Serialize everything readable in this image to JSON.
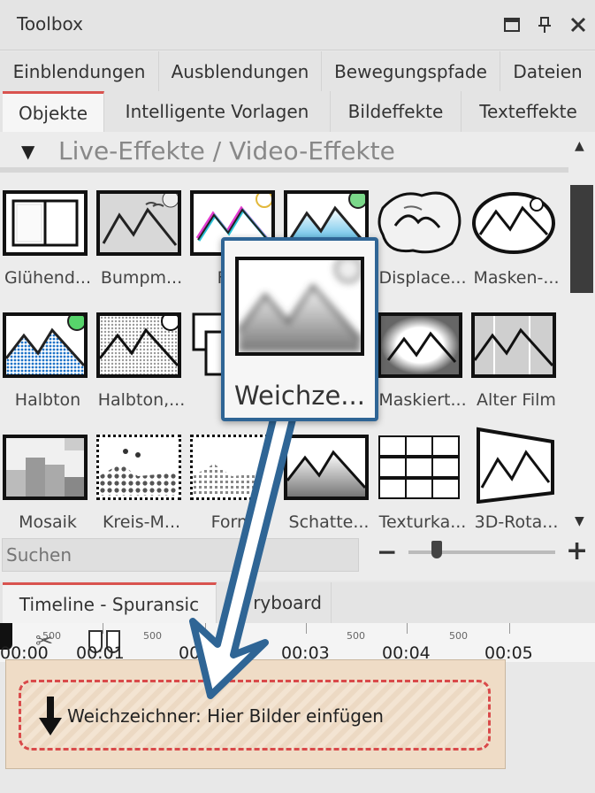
{
  "window": {
    "title": "Toolbox"
  },
  "tabs_row1": [
    "Einblendungen",
    "Ausblendungen",
    "Bewegungspfade",
    "Dateien"
  ],
  "tabs_row2": [
    "Objekte",
    "Intelligente Vorlagen",
    "Bildeffekte",
    "Texteffekte"
  ],
  "active_tab": "Objekte",
  "section": {
    "label": "Live-Effekte / Video-Effekte",
    "expanded": true
  },
  "effects": [
    [
      "Glühend...",
      "Bumpm...",
      "Farb",
      "",
      "Displace...",
      "Masken-..."
    ],
    [
      "Halbton",
      "Halbton,...",
      "Ebe",
      "",
      "Maskiert...",
      "Alter Film"
    ],
    [
      "Mosaik",
      "Kreis-M...",
      "Form-",
      "Schatte...",
      "Texturka...",
      "3D-Rota..."
    ]
  ],
  "search": {
    "placeholder": "Suchen",
    "value": ""
  },
  "zoom": {
    "minus": "−",
    "plus": "+",
    "level": 0.17
  },
  "timeline": {
    "tabs": [
      "Timeline - Spuransic",
      "ryboard"
    ],
    "ticks": [
      "00:00",
      "00:01",
      "00:0",
      "00:03",
      "00:04",
      "00:05"
    ],
    "minor": [
      "500",
      "500",
      "500",
      "500"
    ]
  },
  "dropzone": {
    "text": "Weichzeichner: Hier Bilder einfügen"
  },
  "tooltip": {
    "name": "Weichze..."
  },
  "colors": {
    "accent": "#d9534f",
    "tooltip_border": "#2f6595",
    "arrow": "#2f6595"
  }
}
